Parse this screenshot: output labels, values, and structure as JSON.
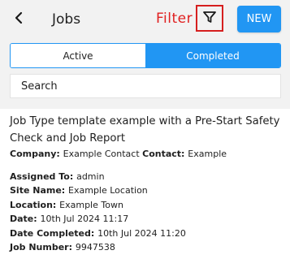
{
  "header": {
    "title": "Jobs",
    "filter_annotation": "Filter",
    "new_label": "NEW",
    "accent_color": "#2196f3",
    "highlight_color": "#d61f1f"
  },
  "tabs": [
    {
      "label": "Active",
      "selected": false
    },
    {
      "label": "Completed",
      "selected": true
    }
  ],
  "search": {
    "placeholder": "Search"
  },
  "job": {
    "title_line1": "Job Type template example with a Pre-Start Safety",
    "title_line2": "Check and Job Report",
    "company_label": "Company:",
    "company_value": "Example Contact",
    "contact_label": "Contact:",
    "contact_value": "Example",
    "assigned_label": "Assigned To:",
    "assigned_value": "admin",
    "site_label": "Site Name:",
    "site_value": "Example Location",
    "location_label": "Location:",
    "location_value": "Example Town",
    "date_label": "Date:",
    "date_value": "10th Jul 2024 11:17",
    "date_completed_label": "Date Completed:",
    "date_completed_value": "10th Jul 2024 11:20",
    "job_number_label": "Job Number:",
    "job_number_value": "9947538"
  }
}
